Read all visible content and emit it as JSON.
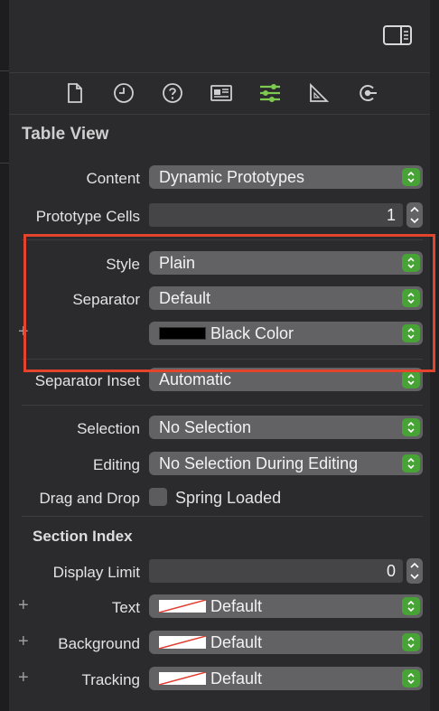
{
  "section_title": "Table View",
  "subsection_title": "Section Index",
  "fields": {
    "content": {
      "label": "Content",
      "value": "Dynamic Prototypes"
    },
    "prototype_cells": {
      "label": "Prototype Cells",
      "value": "1"
    },
    "style": {
      "label": "Style",
      "value": "Plain"
    },
    "separator": {
      "label": "Separator",
      "value": "Default"
    },
    "separator_color": {
      "value": "Black Color",
      "color": "#000000"
    },
    "separator_inset": {
      "label": "Separator Inset",
      "value": "Automatic"
    },
    "selection": {
      "label": "Selection",
      "value": "No Selection"
    },
    "editing": {
      "label": "Editing",
      "value": "No Selection During Editing"
    },
    "drag_drop": {
      "label": "Drag and Drop",
      "value": "Spring Loaded"
    },
    "display_limit": {
      "label": "Display Limit",
      "value": "0"
    },
    "text": {
      "label": "Text",
      "value": "Default"
    },
    "background": {
      "label": "Background",
      "value": "Default"
    },
    "tracking": {
      "label": "Tracking",
      "value": "Default"
    }
  },
  "plus_glyph": "+",
  "tabs": [
    "file-icon",
    "history-icon",
    "help-icon",
    "identity-icon",
    "attributes-icon",
    "size-icon",
    "connections-icon"
  ],
  "colors": {
    "accent_green": "#48a336",
    "active_tab": "#7ec94f",
    "highlight_red": "#e5442c"
  }
}
